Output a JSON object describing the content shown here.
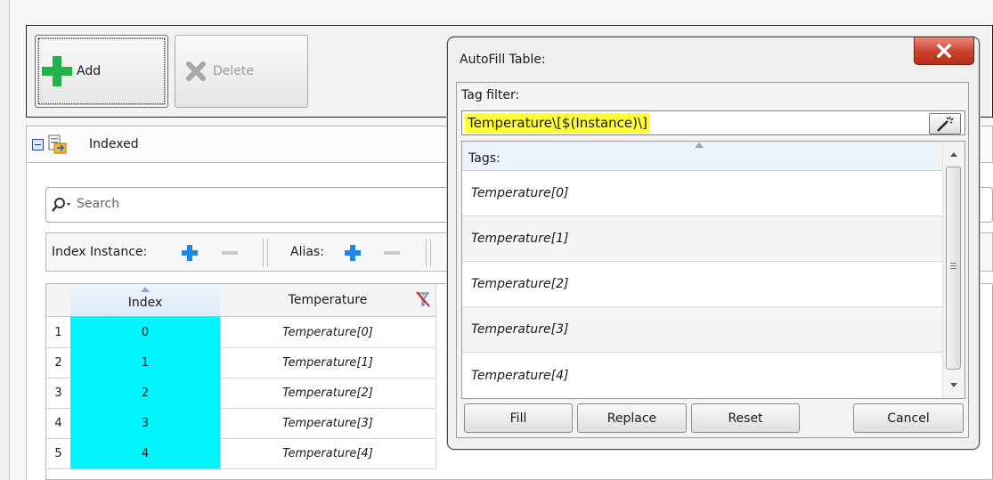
{
  "toolbar": {
    "add_label": "Add",
    "delete_label": "Delete"
  },
  "group": {
    "label": "Indexed"
  },
  "search": {
    "placeholder": "Search"
  },
  "filters": {
    "index_instance_label": "Index Instance:",
    "alias_label": "Alias:"
  },
  "grid": {
    "columns": [
      "Index",
      "Temperature"
    ],
    "rows": [
      {
        "n": "1",
        "index": "0",
        "temperature": "Temperature[0]"
      },
      {
        "n": "2",
        "index": "1",
        "temperature": "Temperature[1]"
      },
      {
        "n": "3",
        "index": "2",
        "temperature": "Temperature[2]"
      },
      {
        "n": "4",
        "index": "3",
        "temperature": "Temperature[3]"
      },
      {
        "n": "5",
        "index": "4",
        "temperature": "Temperature[4]"
      }
    ]
  },
  "dialog": {
    "title": "AutoFill Table:",
    "tag_filter_label": "Tag filter:",
    "tag_filter_value": "Temperature\\[$(Instance)\\]",
    "tags_header": "Tags:",
    "tags": [
      "Temperature[0]",
      "Temperature[1]",
      "Temperature[2]",
      "Temperature[3]",
      "Temperature[4]"
    ],
    "buttons": {
      "fill": "Fill",
      "replace": "Replace",
      "reset": "Reset",
      "cancel": "Cancel"
    }
  },
  "colors": {
    "index_cell": "#00f5ff",
    "filter_highlight": "#ffff33",
    "close_button": "#c8412c",
    "add_plus": "#21b24b",
    "filter_plus": "#1e88e5"
  }
}
